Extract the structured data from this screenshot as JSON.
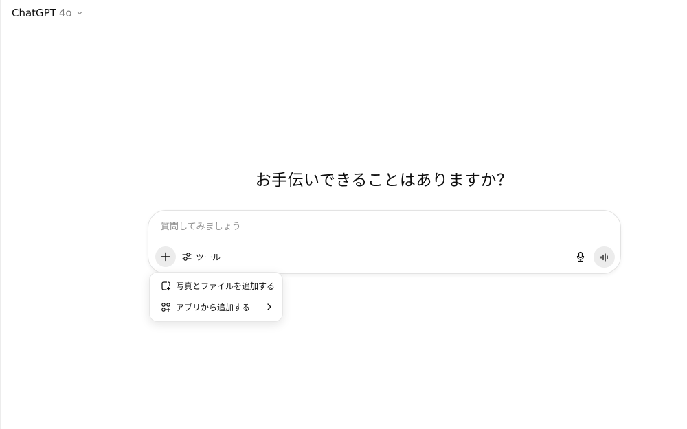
{
  "header": {
    "model_name": "ChatGPT",
    "model_version": "4o"
  },
  "main": {
    "headline": "お手伝いできることはありますか？"
  },
  "composer": {
    "placeholder": "質問してみましょう",
    "value": "",
    "tools_label": "ツール"
  },
  "attach_menu": {
    "items": [
      {
        "label": "写真とファイルを追加する",
        "icon": "attach-file-icon",
        "has_submenu": false
      },
      {
        "label": "アプリから追加する",
        "icon": "apps-add-icon",
        "has_submenu": true
      }
    ]
  },
  "icons": {
    "plus": "plus-icon",
    "tools": "sliders-icon",
    "mic": "microphone-icon",
    "voice": "voice-waveform-icon",
    "model_chevron": "chevron-down-icon",
    "submenu_chevron": "chevron-right-icon"
  },
  "colors": {
    "text": "#0d0d0d",
    "muted": "#7d7d7d",
    "button_bg": "#ececec",
    "border": "#e3e3e3"
  }
}
